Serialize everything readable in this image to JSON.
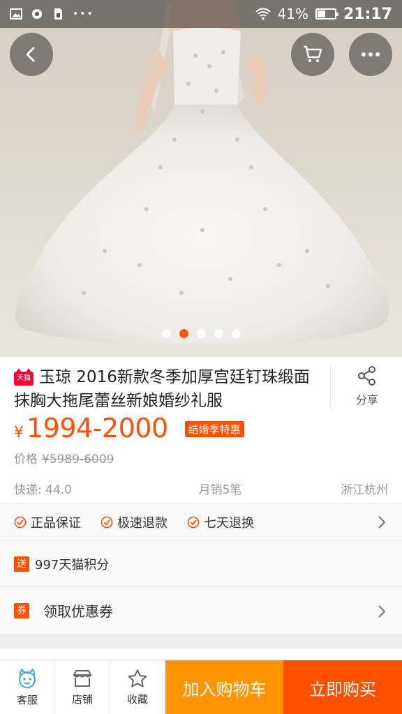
{
  "status_bar": {
    "battery": "41%",
    "battery_level": 0.41,
    "time": "21:17",
    "icons": [
      "gallery-icon",
      "camera-icon",
      "sim-icon",
      "more-dots-icon",
      "wifi-icon",
      "battery-icon"
    ]
  },
  "hero": {
    "carousel_count": 5,
    "active_index": 1,
    "nav_buttons": [
      "back-icon",
      "cart-icon",
      "more-icon"
    ]
  },
  "product": {
    "tmall_badge": "天猫",
    "title": "玉琼 2016新款冬季加厚宫廷钉珠缎面抹胸大拖尾蕾丝新娘婚纱礼服",
    "share_label": "分享",
    "currency": "¥",
    "price": "1994-2000",
    "promo_tag": "结婚季特惠",
    "orig_label": "价格",
    "orig_price": "¥5989-6009",
    "shipping": "快递: 44.0",
    "monthly_sales": "月销5笔",
    "location": "浙江杭州"
  },
  "guarantees": [
    "正品保证",
    "极速退款",
    "七天退换"
  ],
  "points": {
    "tag": "送",
    "text": "997天猫积分"
  },
  "coupon": {
    "tag": "券",
    "text": "领取优惠券"
  },
  "bottom_bar": {
    "service": "客服",
    "shop": "店铺",
    "favorite": "收藏",
    "add_cart": "加入购物车",
    "buy_now": "立即购买"
  },
  "colors": {
    "accent": "#ff5000",
    "cart_button": "#ff9402",
    "tmall_red": "#ff0036"
  }
}
